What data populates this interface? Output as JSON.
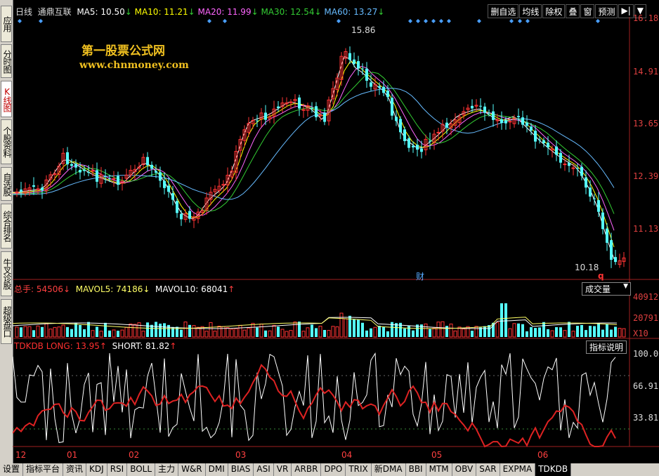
{
  "sidebar": {
    "items": [
      {
        "label": "应用",
        "active": false
      },
      {
        "label": "分时图",
        "active": false
      },
      {
        "label": "K线图",
        "active": true
      },
      {
        "label": "个股资料",
        "active": false
      },
      {
        "label": "自选股",
        "active": false
      },
      {
        "label": "综合排名",
        "active": false
      },
      {
        "label": "牛叉诊股",
        "active": false
      },
      {
        "label": "超级盘口",
        "active": false
      }
    ]
  },
  "toolbar": {
    "items": [
      "删自选",
      "均线",
      "除权",
      "叠",
      "窗",
      "预测",
      "▶|",
      "▼"
    ]
  },
  "main_chart": {
    "period": "日线",
    "stock_name": "通鼎互联",
    "ma": [
      {
        "label": "MA5: 10.50",
        "arrow": "↓",
        "color": "#ffffff"
      },
      {
        "label": "MA10: 11.21",
        "arrow": "↓",
        "color": "#ffff00"
      },
      {
        "label": "MA20: 11.99",
        "arrow": "↓",
        "color": "#ff66ff"
      },
      {
        "label": "MA30: 12.54",
        "arrow": "↓",
        "color": "#33cc33"
      },
      {
        "label": "MA60: 13.27",
        "arrow": "↓",
        "color": "#66bbff"
      }
    ],
    "price_axis": [
      "16.18",
      "14.91",
      "13.65",
      "12.39",
      "11.13"
    ],
    "high_label": "15.86",
    "low_label": "10.18",
    "cai_marker": "财",
    "q_marker": "q"
  },
  "watermark": {
    "line1": "第一股票公式网",
    "line2": "www.chnmoney.com"
  },
  "volume": {
    "total_label": "总手: 54506",
    "total_arrow": "↓",
    "mavol5": "MAVOL5: 74186",
    "mavol5_arrow": "↓",
    "mavol10": "MAVOL10: 68041",
    "mavol10_arrow": "↑",
    "axis": [
      "40912",
      "20791",
      "X10"
    ],
    "dropdown": "成交量"
  },
  "indicator": {
    "long_label": "TDKDB LONG: 13.95",
    "long_arrow": "↑",
    "short_label": "SHORT: 81.82",
    "short_arrow": "↑",
    "axis": [
      "100.00",
      "66.91",
      "33.81"
    ],
    "help_button": "指标说明"
  },
  "x_axis": [
    "12",
    "01",
    "02",
    "03",
    "04",
    "05",
    "06"
  ],
  "tabs": [
    "设置",
    "指标平台",
    "资讯",
    "KDJ",
    "RSI",
    "BOLL",
    "主力",
    "W&R",
    "DMI",
    "BIAS",
    "ASI",
    "VR",
    "ARBR",
    "DPO",
    "TRIX",
    "新DMA",
    "BBI",
    "MTM",
    "OBV",
    "SAR",
    "EXPMA",
    "TDKDB"
  ],
  "active_tab": "TDKDB",
  "colors": {
    "up": "#ff3333",
    "down": "#55ffff",
    "long": "#dd2222",
    "short": "#ffffff",
    "accent": "#e04040"
  }
}
